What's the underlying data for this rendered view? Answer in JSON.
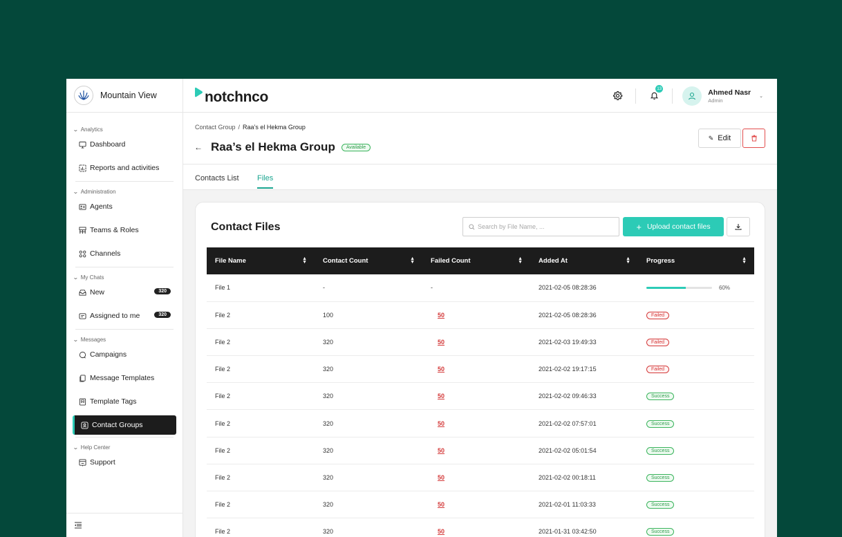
{
  "sidebar": {
    "org_name": "Mountain View",
    "sections": [
      {
        "label": "Analytics",
        "items": [
          {
            "label": "Dashboard"
          },
          {
            "label": "Reports and activities"
          }
        ]
      },
      {
        "label": "Administration",
        "items": [
          {
            "label": "Agents"
          },
          {
            "label": "Teams & Roles"
          },
          {
            "label": "Channels"
          }
        ]
      },
      {
        "label": "My Chats",
        "items": [
          {
            "label": "New",
            "badge": "320"
          },
          {
            "label": "Assigned to me",
            "badge": "320"
          }
        ]
      },
      {
        "label": "Messages",
        "items": [
          {
            "label": "Campaigns"
          },
          {
            "label": "Message Templates"
          },
          {
            "label": "Template Tags"
          },
          {
            "label": "Contact Groups"
          }
        ]
      },
      {
        "label": "Help Center",
        "items": [
          {
            "label": "Support"
          }
        ]
      }
    ]
  },
  "topbar": {
    "logo_text": "notchnco",
    "notification_count": "13",
    "user_name": "Ahmed Nasr",
    "user_role": "Admin"
  },
  "header": {
    "breadcrumb": [
      "Contact Group",
      "Raa’s el Hekma Group"
    ],
    "breadcrumb_sep": "/",
    "title": "Raa’s el Hekma Group",
    "status": "Available",
    "edit_label": "Edit"
  },
  "tabs": [
    "Contacts List",
    "Files"
  ],
  "active_tab": "Files",
  "files": {
    "title": "Contact Files",
    "search_placeholder": "Search by File Name, ...",
    "upload_label": "Upload contact files",
    "columns": [
      "File Name",
      "Contact Count",
      "Failed Count",
      "Added At",
      "Progress"
    ],
    "rows": [
      {
        "name": "File 1",
        "contact_count": "-",
        "failed_count": "-",
        "added_at": "2021-02-05 08:28:36",
        "progress": 0.6,
        "progress_label": "60%"
      },
      {
        "name": "File 2",
        "contact_count": "100",
        "failed_count": "50",
        "added_at": "2021-02-05 08:28:36",
        "status": "Failed"
      },
      {
        "name": "File 2",
        "contact_count": "320",
        "failed_count": "50",
        "added_at": "2021-02-03 19:49:33",
        "status": "Failed"
      },
      {
        "name": "File 2",
        "contact_count": "320",
        "failed_count": "50",
        "added_at": "2021-02-02 19:17:15",
        "status": "Failed"
      },
      {
        "name": "File 2",
        "contact_count": "320",
        "failed_count": "50",
        "added_at": "2021-02-02 09:46:33",
        "status": "Success"
      },
      {
        "name": "File 2",
        "contact_count": "320",
        "failed_count": "50",
        "added_at": "2021-02-02 07:57:01",
        "status": "Success"
      },
      {
        "name": "File 2",
        "contact_count": "320",
        "failed_count": "50",
        "added_at": "2021-02-02 05:01:54",
        "status": "Success"
      },
      {
        "name": "File 2",
        "contact_count": "320",
        "failed_count": "50",
        "added_at": "2021-02-02 00:18:11",
        "status": "Success"
      },
      {
        "name": "File 2",
        "contact_count": "320",
        "failed_count": "50",
        "added_at": "2021-02-01 11:03:33",
        "status": "Success"
      },
      {
        "name": "File 2",
        "contact_count": "320",
        "failed_count": "50",
        "added_at": "2021-01-31 03:42:50",
        "status": "Success"
      }
    ]
  },
  "colors": {
    "background": "#04483a",
    "accent": "#2ccbb6",
    "danger": "#d43a3a",
    "success": "#39b35b",
    "table_header": "#1c1c1c"
  },
  "icons": {
    "sidebar": [
      "monitor-icon",
      "chart-icon",
      "agents-icon",
      "teams-icon",
      "channels-icon",
      "inbox-icon",
      "assigned-icon",
      "campaign-icon",
      "template-icon",
      "tag-icon",
      "contact-group-icon",
      "support-icon"
    ]
  }
}
